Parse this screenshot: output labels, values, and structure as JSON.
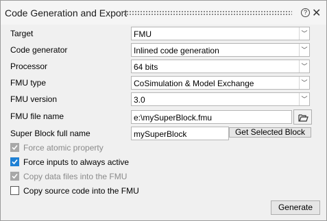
{
  "window": {
    "title": "Code Generation and Export"
  },
  "fields": {
    "target": {
      "label": "Target",
      "value": "FMU"
    },
    "code_generator": {
      "label": "Code generator",
      "value": "Inlined code generation"
    },
    "processor": {
      "label": "Processor",
      "value": "64 bits"
    },
    "fmu_type": {
      "label": "FMU type",
      "value": "CoSimulation & Model Exchange"
    },
    "fmu_version": {
      "label": "FMU version",
      "value": "3.0"
    },
    "fmu_file_name": {
      "label": "FMU file name",
      "value": "e:\\mySuperBlock.fmu"
    },
    "super_block": {
      "label": "Super Block full name",
      "value": "mySuperBlock",
      "button": "Get Selected Block"
    }
  },
  "options": {
    "force_atomic": {
      "label": "Force atomic property",
      "checked": true,
      "enabled": false
    },
    "force_inputs": {
      "label": "Force inputs to always active",
      "checked": true,
      "enabled": true
    },
    "copy_data": {
      "label": "Copy data files into the FMU",
      "checked": true,
      "enabled": false
    },
    "copy_source": {
      "label": "Copy source code into the FMU",
      "checked": false,
      "enabled": true
    }
  },
  "actions": {
    "generate": "Generate"
  },
  "icons": {
    "help": "help-circle-icon",
    "close": "close-icon",
    "dropdown": "chevron-down-icon",
    "folder": "folder-open-icon",
    "check": "check-icon"
  },
  "colors": {
    "accent": "#1e80d4",
    "disabled": "#a8a8a8"
  }
}
